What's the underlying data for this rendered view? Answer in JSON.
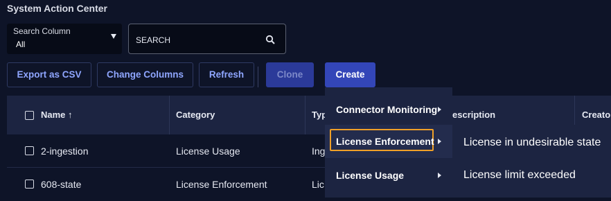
{
  "app": {
    "title": "System Action Center"
  },
  "search_column": {
    "label": "Search Column",
    "value": "All"
  },
  "search": {
    "placeholder": "SEARCH"
  },
  "toolbar": {
    "export_label": "Export as CSV",
    "change_columns_label": "Change Columns",
    "refresh_label": "Refresh",
    "clone_label": "Clone",
    "create_label": "Create"
  },
  "table": {
    "columns": {
      "name": "Name",
      "category": "Category",
      "type": "Typ",
      "description": "escription",
      "creator": "Creato"
    },
    "sort_indicator": "↑",
    "rows": [
      {
        "name": "2-ingestion",
        "category": "License Usage",
        "type": "Ing"
      },
      {
        "name": "608-state",
        "category": "License Enforcement",
        "type": "Lic"
      }
    ]
  },
  "create_menu": {
    "items": [
      {
        "label": "Connector Monitoring"
      },
      {
        "label": "License Enforcement"
      },
      {
        "label": "License Usage"
      }
    ]
  },
  "submenu": {
    "items": [
      {
        "label": "License in undesirable state"
      },
      {
        "label": "License limit exceeded"
      }
    ]
  },
  "colors": {
    "accent": "#3346b8",
    "focus": "#f0a028",
    "background": "#0e1428",
    "header": "#1c2441"
  }
}
